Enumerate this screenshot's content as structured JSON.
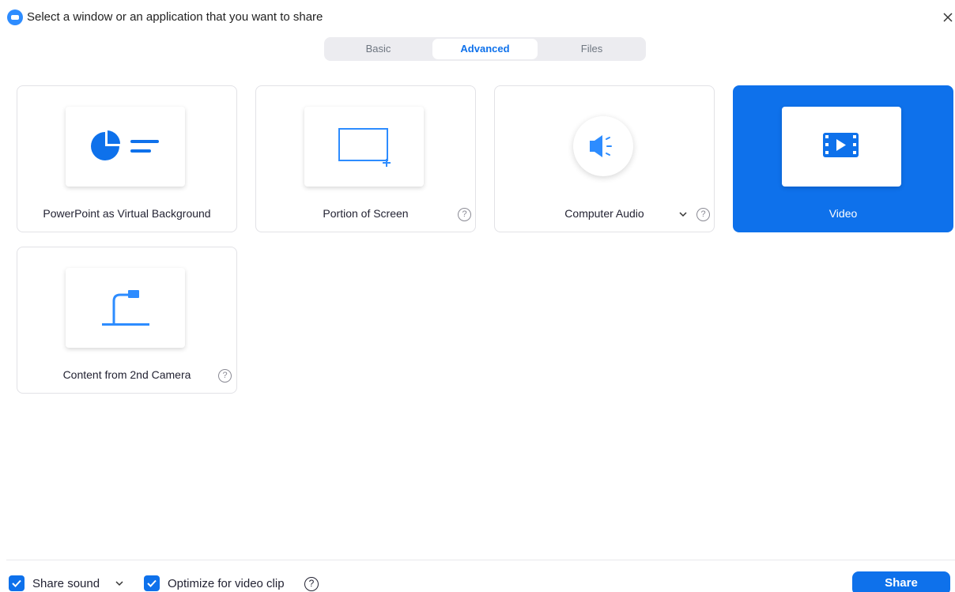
{
  "window": {
    "title": "Select a window or an application that you want to share",
    "logo_icon": "zoom-logo-icon",
    "close_icon": "close-icon"
  },
  "tabs": [
    {
      "label": "Basic",
      "active": false
    },
    {
      "label": "Advanced",
      "active": true
    },
    {
      "label": "Files",
      "active": false
    }
  ],
  "options": [
    {
      "label": "PowerPoint as Virtual Background",
      "icon": "powerpoint-background-icon",
      "help": false,
      "selected": false
    },
    {
      "label": "Portion of Screen",
      "icon": "screen-portion-icon",
      "help": true,
      "selected": false
    },
    {
      "label": "Computer Audio",
      "icon": "speaker-icon",
      "help": true,
      "dropdown": true,
      "selected": false
    },
    {
      "label": "Video",
      "icon": "video-file-icon",
      "help": false,
      "selected": true
    },
    {
      "label": "Content from 2nd Camera",
      "icon": "document-camera-icon",
      "help": true,
      "selected": false
    }
  ],
  "help_glyph": "?",
  "footer": {
    "share_sound": {
      "label": "Share sound",
      "checked": true
    },
    "optimize_video": {
      "label": "Optimize for video clip",
      "checked": true
    },
    "help_glyph": "?",
    "share_button": "Share"
  },
  "colors": {
    "accent": "#0e71eb",
    "icon_blue": "#2d8cff",
    "text": "#232333",
    "tab_bg": "#ececf0"
  }
}
